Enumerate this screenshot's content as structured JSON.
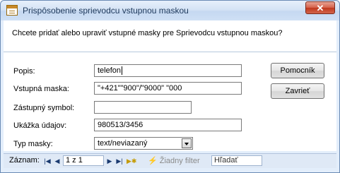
{
  "window": {
    "title": "Prispôsobenie sprievodcu vstupnou maskou",
    "close_glyph": "✕"
  },
  "dialog": {
    "description": "Chcete pridať alebo upraviť vstupné masky pre Sprievodcu vstupnou maskou?",
    "fields": {
      "popis_label": "Popis:",
      "popis_value": "telefon",
      "vstupna_maska_label": "Vstupná maska:",
      "vstupna_maska_value": "\"+421\"\"900\"/\"9000\" \"000",
      "zastupny_symbol_label": "Zástupný symbol:",
      "zastupny_symbol_value": "",
      "ukazka_udajov_label": "Ukážka údajov:",
      "ukazka_udajov_value": "980513/3456",
      "typ_masky_label": "Typ masky:",
      "typ_masky_value": "text/neviazaný"
    },
    "buttons": {
      "help": "Pomocník",
      "close": "Zavrieť"
    }
  },
  "navigation": {
    "record_label": "Záznam:",
    "first_icon": "first-record-icon",
    "prev_icon": "previous-record-icon",
    "record_position": "1 z 1",
    "next_icon": "next-record-icon",
    "last_icon": "last-record-icon",
    "new_icon": "new-record-icon",
    "filter_label": "Žiadny filter",
    "search_placeholder": "Hľadať"
  },
  "colors": {
    "accent": "#1e395b",
    "close_button": "#c0391e",
    "window_border": "#6b8bb5"
  }
}
